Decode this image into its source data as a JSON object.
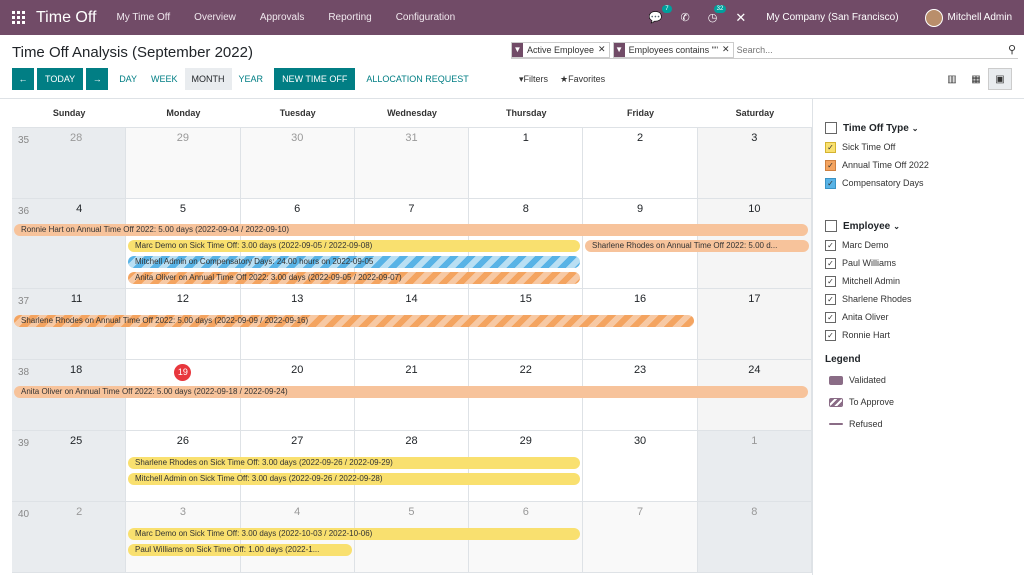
{
  "topbar": {
    "app_name": "Time Off",
    "menu": [
      "My Time Off",
      "Overview",
      "Approvals",
      "Reporting",
      "Configuration"
    ],
    "messages_badge": "7",
    "activities_badge": "32",
    "company": "My Company (San Francisco)",
    "user": "Mitchell Admin"
  },
  "page": {
    "title": "Time Off Analysis (September 2022)"
  },
  "search": {
    "facets": [
      "Active Employee",
      "Employees contains \"\""
    ],
    "placeholder": "Search..."
  },
  "buttons": {
    "today": "TODAY",
    "day": "DAY",
    "week": "WEEK",
    "month": "MONTH",
    "year": "YEAR",
    "new_time_off": "NEW TIME OFF",
    "allocation_request": "ALLOCATION REQUEST",
    "filters": "Filters",
    "favorites": "Favorites"
  },
  "calendar": {
    "weekdays": [
      "Sunday",
      "Monday",
      "Tuesday",
      "Wednesday",
      "Thursday",
      "Friday",
      "Saturday"
    ],
    "weeks": [
      {
        "num": "35",
        "days": [
          "28",
          "29",
          "30",
          "31",
          "1",
          "2",
          "3"
        ]
      },
      {
        "num": "36",
        "days": [
          "4",
          "5",
          "6",
          "7",
          "8",
          "9",
          "10"
        ]
      },
      {
        "num": "37",
        "days": [
          "11",
          "12",
          "13",
          "14",
          "15",
          "16",
          "17"
        ]
      },
      {
        "num": "38",
        "days": [
          "18",
          "19",
          "20",
          "21",
          "22",
          "23",
          "24"
        ]
      },
      {
        "num": "39",
        "days": [
          "25",
          "26",
          "27",
          "28",
          "29",
          "30",
          "1"
        ]
      },
      {
        "num": "40",
        "days": [
          "2",
          "3",
          "4",
          "5",
          "6",
          "7",
          "8"
        ]
      }
    ],
    "events": {
      "w36_ronnie": "Ronnie Hart on Annual Time Off 2022: 5.00 days (2022-09-04 / 2022-09-10)",
      "w36_marc": "Marc Demo on Sick Time Off: 3.00 days (2022-09-05 / 2022-09-08)",
      "w36_sharlene": "Sharlene Rhodes on Annual Time Off 2022: 5.00 d...",
      "w36_mitchell": "Mitchell Admin on Compensatory Days: 24.00 hours on 2022-09-05",
      "w36_anita": "Anita Oliver on Annual Time Off 2022: 3.00 days (2022-09-05 / 2022-09-07)",
      "w37_sharlene": "Sharlene Rhodes on Annual Time Off 2022: 5.00 days (2022-09-09 / 2022-09-16)",
      "w38_anita": "Anita Oliver on Annual Time Off 2022: 5.00 days (2022-09-18 / 2022-09-24)",
      "w39_sharlene": "Sharlene Rhodes on Sick Time Off: 3.00 days (2022-09-26 / 2022-09-29)",
      "w39_mitchell": "Mitchell Admin on Sick Time Off: 3.00 days (2022-09-26 / 2022-09-28)",
      "w40_marc": "Marc Demo on Sick Time Off: 3.00 days (2022-10-03 / 2022-10-06)",
      "w40_paul": "Paul Williams on Sick Time Off: 1.00 days (2022-1..."
    }
  },
  "sidebar": {
    "time_off_type_title": "Time Off Type",
    "time_off_types": [
      "Sick Time Off",
      "Annual Time Off 2022",
      "Compensatory Days"
    ],
    "employee_title": "Employee",
    "employees": [
      "Marc Demo",
      "Paul Williams",
      "Mitchell Admin",
      "Sharlene Rhodes",
      "Anita Oliver",
      "Ronnie Hart"
    ],
    "legend_title": "Legend",
    "legend": [
      "Validated",
      "To Approve",
      "Refused"
    ]
  },
  "colors": {
    "brand": "#714b67",
    "primary": "#017e84",
    "today": "#e8373d",
    "sick": "#f9e06f",
    "annual": "#f4a460",
    "compensatory": "#58b3e6"
  }
}
